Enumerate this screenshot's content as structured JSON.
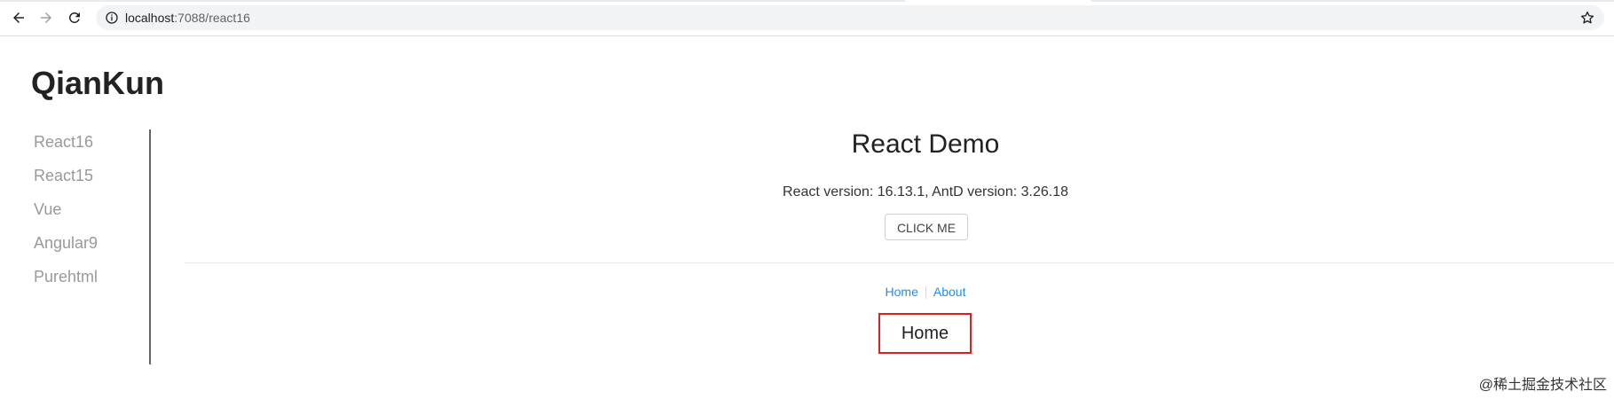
{
  "browser": {
    "url_host": "localhost",
    "url_rest": ":7088/react16",
    "icons": {
      "back": "back-arrow-icon",
      "forward": "forward-arrow-icon",
      "reload": "reload-icon",
      "info": "info-icon",
      "bookmark": "star-icon"
    }
  },
  "app": {
    "logo": "QianKun",
    "sidebar": {
      "items": [
        {
          "label": "React16"
        },
        {
          "label": "React15"
        },
        {
          "label": "Vue"
        },
        {
          "label": "Angular9"
        },
        {
          "label": "Purehtml"
        }
      ]
    }
  },
  "main": {
    "title": "React Demo",
    "version_text": "React version: 16.13.1, AntD version: 3.26.18",
    "click_label": "CLICK ME",
    "links": {
      "home": "Home",
      "about": "About"
    },
    "route_content": "Home"
  },
  "watermark": "@稀土掘金技术社区",
  "colors": {
    "link": "#1890ff",
    "highlight_border": "#e02020",
    "sidebar_text": "#999999"
  }
}
